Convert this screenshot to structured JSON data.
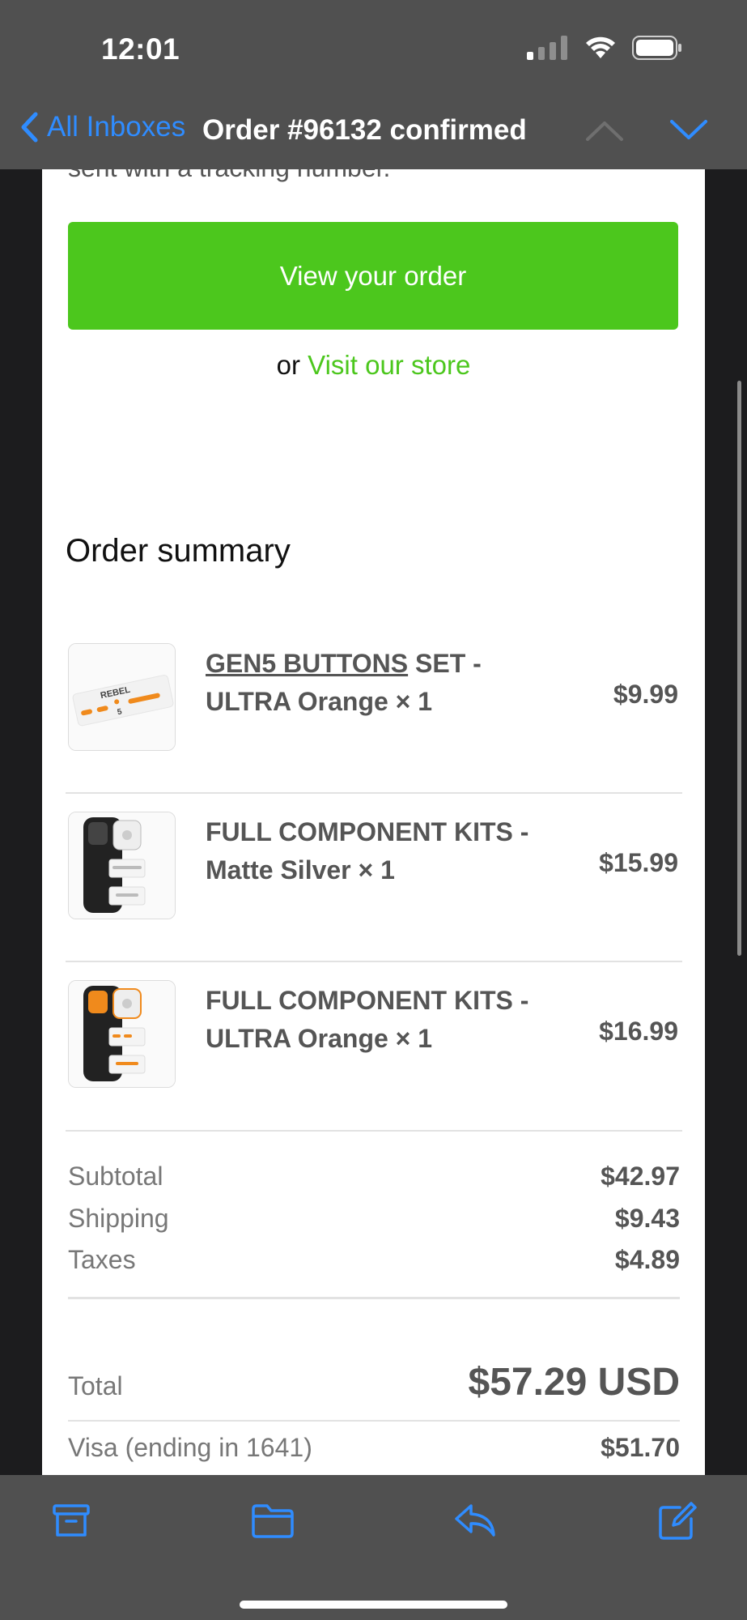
{
  "status_bar": {
    "time": "12:01"
  },
  "nav": {
    "back_label": "All Inboxes",
    "title": "Order #96132 confirmed"
  },
  "email": {
    "cut_top_text": "sent with a tracking number.",
    "view_order_button": "View your order",
    "or_text": "or",
    "visit_store_link": "Visit our store",
    "summary_title": "Order summary",
    "items": [
      {
        "name_part1": "GEN5 BUTTONS",
        "name_part2": " SET - ULTRA Orange × 1",
        "price": "$9.99"
      },
      {
        "name_part1": "",
        "name_part2": "FULL COMPONENT KITS - Matte Silver × 1",
        "price": "$15.99"
      },
      {
        "name_part1": "",
        "name_part2": "FULL COMPONENT KITS - ULTRA Orange × 1",
        "price": "$16.99"
      }
    ],
    "totals": [
      {
        "label": "Subtotal",
        "value": "$42.97"
      },
      {
        "label": "Shipping",
        "value": "$9.43"
      },
      {
        "label": "Taxes",
        "value": "$4.89"
      }
    ],
    "total_label": "Total",
    "total_value": "$57.29 USD",
    "payment_label": "Visa (ending in 1641)",
    "payment_value": "$51.70"
  },
  "colors": {
    "accent_green": "#4cc71d",
    "ios_blue": "#2f8cff"
  },
  "toolbar": {
    "icons": [
      "archive-icon",
      "folder-icon",
      "reply-icon",
      "compose-icon"
    ]
  }
}
